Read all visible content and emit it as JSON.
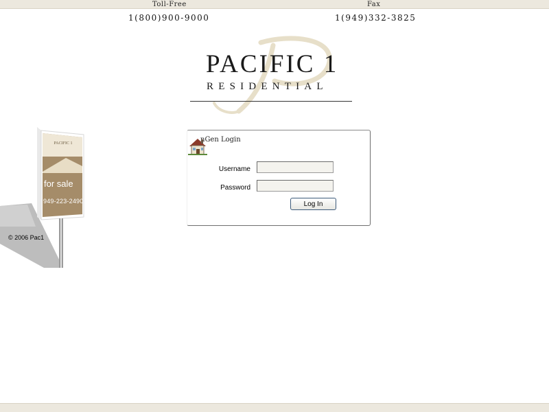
{
  "contact": {
    "toll_free_label": "Toll-Free",
    "toll_free_number": "1(800)900-9000",
    "fax_label": "Fax",
    "fax_number": "1(949)332-3825"
  },
  "logo": {
    "main": "PACIFIC 1",
    "sub": "RESIDENTIAL",
    "watermark_letter": "P"
  },
  "sign": {
    "brand": "PACIFIC 1",
    "tagline": "for sale",
    "phone": "949-223-2490",
    "copyright": "© 2006 Pac1"
  },
  "login": {
    "title": "nGen Login",
    "username_label": "Username",
    "password_label": "Password",
    "username_value": "",
    "password_value": "",
    "button_label": "Log In"
  },
  "colors": {
    "bar": "#ece8de",
    "watermark": "#e7dfc9",
    "sign_panel": "#a58c69",
    "button_border": "#3c5a7a"
  },
  "icons": {
    "house": "house-icon"
  }
}
